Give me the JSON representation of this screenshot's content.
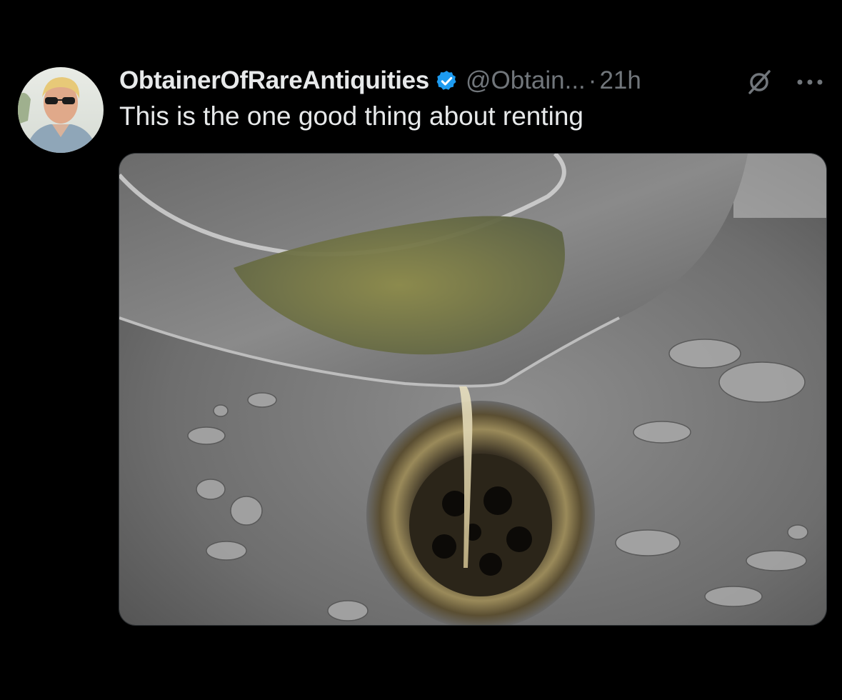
{
  "tweet": {
    "display_name": "ObtainerOfRareAntiquities",
    "handle": "@Obtain...",
    "separator": "·",
    "time": "21h",
    "text": "This is the one good thing about renting",
    "verified": true,
    "icons": {
      "verified": "verified-badge-icon",
      "grok": "grok-icon",
      "more": "more-options-icon"
    }
  },
  "colors": {
    "background": "#000000",
    "primary_text": "#e7e9ea",
    "secondary_text": "#71767b",
    "verified_blue": "#1d9bf0"
  }
}
